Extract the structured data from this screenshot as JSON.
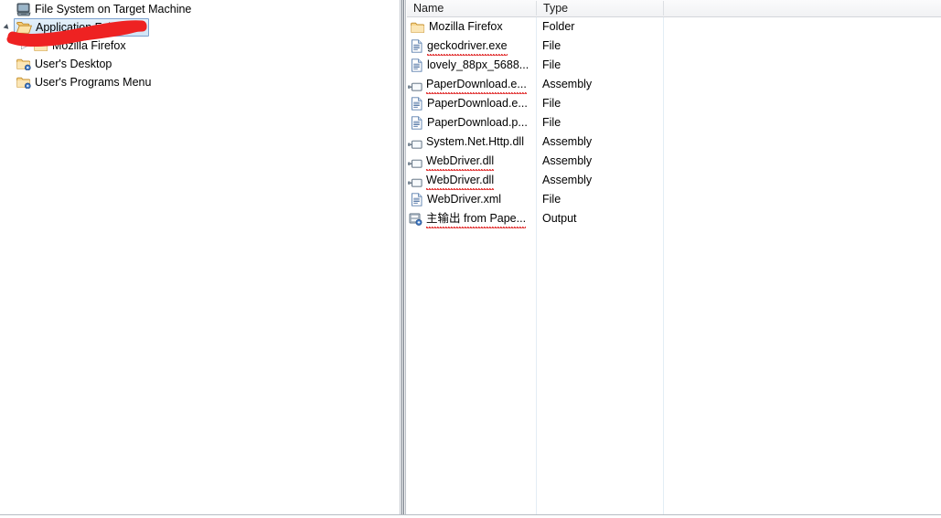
{
  "window": {
    "kind": "file-system-editor",
    "accent_selection": "#cfe4f6",
    "annotation_color": "#ee2222"
  },
  "tree": {
    "name": "File System on Target Machine tree",
    "nodes": [
      {
        "label": "File System on Target Machine",
        "icon": "computer-icon",
        "indent": 0,
        "expander": "none",
        "selected": false
      },
      {
        "label": "Application Folder",
        "icon": "open-folder-icon",
        "indent": 1,
        "expander": "expanded",
        "selected": true
      },
      {
        "label": "Mozilla Firefox",
        "icon": "folder-icon",
        "indent": 2,
        "expander": "collapsed",
        "selected": false
      },
      {
        "label": "User's Desktop",
        "icon": "special-folder-icon",
        "indent": 1,
        "expander": "none",
        "selected": false
      },
      {
        "label": "User's Programs Menu",
        "icon": "special-folder-icon",
        "indent": 1,
        "expander": "none",
        "selected": false
      }
    ]
  },
  "list": {
    "name": "Application Folder contents",
    "columns": [
      "Name",
      "Type"
    ],
    "rows": [
      {
        "name": "Mozilla Firefox",
        "type": "Folder",
        "icon": "folder-icon",
        "squiggle": false
      },
      {
        "name": "geckodriver.exe",
        "type": "File",
        "icon": "file-icon",
        "squiggle": true
      },
      {
        "name": "lovely_88px_5688...",
        "type": "File",
        "icon": "file-icon",
        "squiggle": false
      },
      {
        "name": "PaperDownload.e...",
        "type": "Assembly",
        "icon": "assembly-icon",
        "squiggle": true
      },
      {
        "name": "PaperDownload.e...",
        "type": "File",
        "icon": "file-icon",
        "squiggle": false
      },
      {
        "name": "PaperDownload.p...",
        "type": "File",
        "icon": "file-icon",
        "squiggle": false
      },
      {
        "name": "System.Net.Http.dll",
        "type": "Assembly",
        "icon": "assembly-icon",
        "squiggle": false
      },
      {
        "name": "WebDriver.dll",
        "type": "Assembly",
        "icon": "assembly-icon",
        "squiggle": true
      },
      {
        "name": "WebDriver.dll",
        "type": "Assembly",
        "icon": "assembly-icon",
        "squiggle": true
      },
      {
        "name": "WebDriver.xml",
        "type": "File",
        "icon": "file-icon",
        "squiggle": false
      },
      {
        "name": "主输出 from Pape...",
        "type": "Output",
        "icon": "project-output-icon",
        "squiggle": true
      }
    ]
  },
  "annotation": {
    "name": "red-scribble-over-application-folder",
    "shape": "hand-drawn-stroke"
  }
}
